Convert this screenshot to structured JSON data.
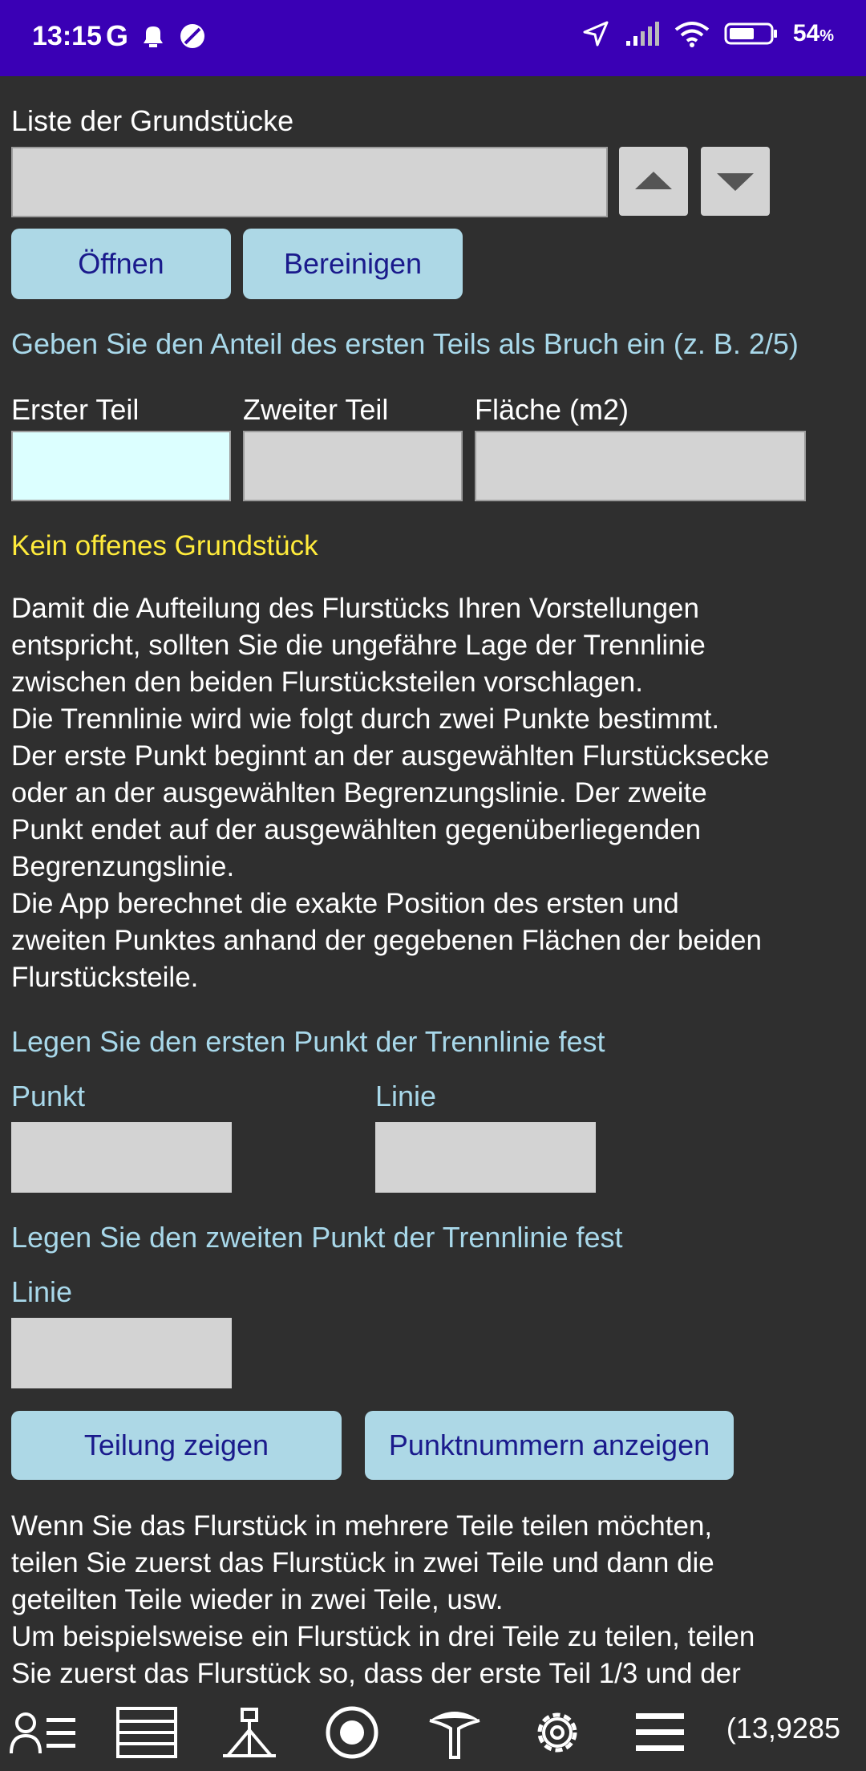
{
  "status_bar": {
    "time": "13:15",
    "carrier_letter": "G",
    "battery_percent": "54",
    "battery_suffix": "%"
  },
  "plots": {
    "list_label": "Liste der Grundstücke",
    "open_button": "Öffnen",
    "clear_button": "Bereinigen"
  },
  "fraction": {
    "instruction": "Geben Sie den Anteil des ersten Teils als Bruch ein (z. B. 2/5)",
    "first_part_label": "Erster Teil",
    "second_part_label": "Zweiter Teil",
    "area_label": "Fläche (m2)"
  },
  "status_message": "Kein offenes Grundstück",
  "description": {
    "lines": [
      "Damit die Aufteilung des Flurstücks Ihren Vorstellungen",
      "entspricht, sollten Sie die ungefähre Lage der Trennlinie",
      "zwischen den beiden Flurstücksteilen vorschlagen.",
      "Die Trennlinie wird wie folgt durch zwei Punkte bestimmt.",
      "Der erste Punkt beginnt an der ausgewählten Flurstücksecke",
      "oder an der ausgewählten Begrenzungslinie. Der zweite",
      "Punkt endet auf der ausgewählten gegenüberliegenden",
      "Begrenzungslinie.",
      "Die App berechnet die exakte Position des ersten und",
      "zweiten Punktes anhand der gegebenen Flächen der beiden",
      "Flurstücksteile."
    ]
  },
  "first_point": {
    "heading": "Legen Sie den ersten Punkt der Trennlinie fest",
    "point_label": "Punkt",
    "line_label": "Linie"
  },
  "second_point": {
    "heading": "Legen Sie den zweiten Punkt der Trennlinie fest",
    "line_label": "Linie"
  },
  "actions": {
    "show_division": "Teilung zeigen",
    "show_point_numbers": "Punktnummern anzeigen"
  },
  "footer_text": {
    "lines": [
      "Wenn Sie das Flurstück in mehrere Teile teilen möchten,",
      "teilen Sie zuerst das Flurstück in zwei Teile und dann die",
      "geteilten Teile wieder in zwei Teile, usw.",
      "Um beispielsweise ein Flurstück in drei Teile zu teilen, teilen",
      "Sie zuerst das Flurstück so, dass der erste Teil 1/3 und der"
    ]
  },
  "bottom_nav": {
    "icons": [
      "user-list-icon",
      "list-icon",
      "surveyor-icon",
      "target-icon",
      "pin-icon",
      "gear-icon",
      "menu-icon"
    ],
    "coordinate": "(13,9285"
  },
  "colors": {
    "status_bar_bg": "#3a00b5",
    "background": "#2f2f2f",
    "button_bg": "#add8e6",
    "button_text": "#1a1a8c",
    "accent_text": "#a8d8ea",
    "warning_text": "#ffeb3b",
    "active_field": "#dcffff"
  }
}
